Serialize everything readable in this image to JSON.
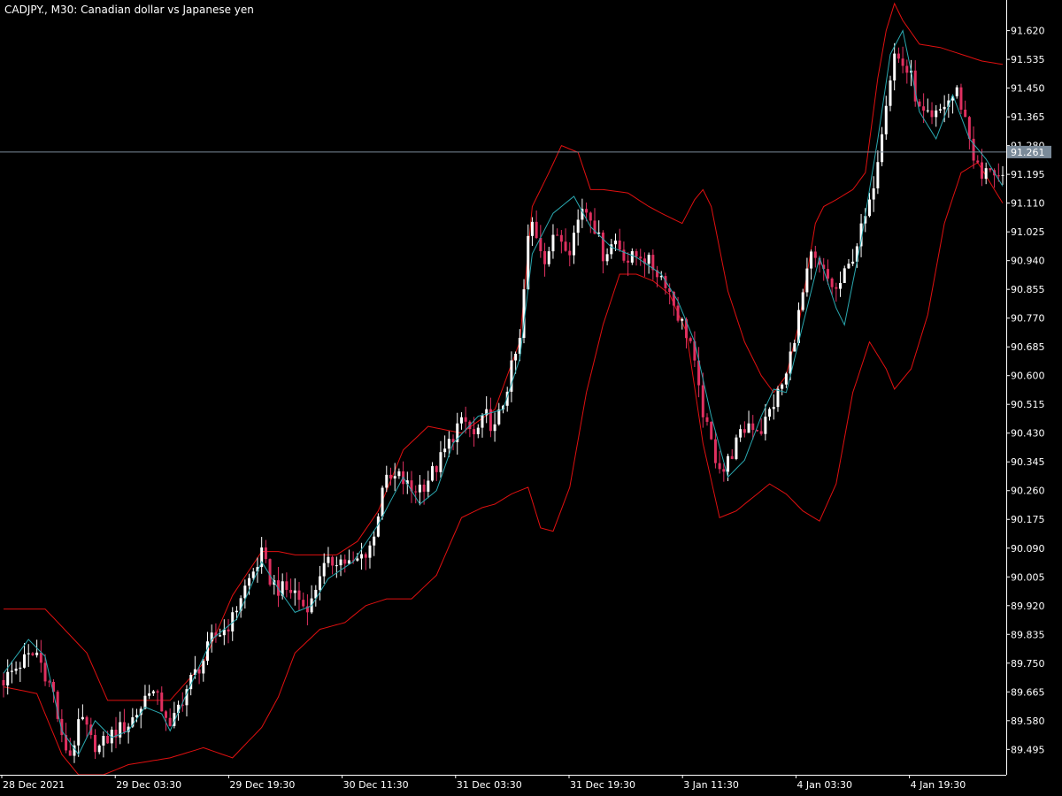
{
  "window": {
    "symbol": "CADJPY.",
    "timeframe": "M30",
    "description": "Canadian dollar vs Japanese yen",
    "title": "CADJPY., M30:  Canadian dollar vs Japanese yen"
  },
  "colors": {
    "background": "#000000",
    "frame": "#ffffff",
    "bull_candle": "#ffffff",
    "bear_candle": "#e03060",
    "bands": "#e01010",
    "signal_line": "#2aa8b0",
    "price_line": "#7a8a99",
    "price_label_bg": "#7a8a99",
    "text": "#ffffff"
  },
  "price_label": "91.261",
  "chart_data": {
    "type": "candlestick",
    "title": "CADJPY., M30:  Canadian dollar vs Japanese yen",
    "ylim": [
      89.42,
      91.7
    ],
    "y_ticks": [
      "89.495",
      "89.580",
      "89.665",
      "89.750",
      "89.835",
      "89.920",
      "90.005",
      "90.090",
      "90.175",
      "90.260",
      "90.345",
      "90.430",
      "90.515",
      "90.600",
      "90.685",
      "90.770",
      "90.855",
      "90.940",
      "91.025",
      "91.110",
      "91.195",
      "91.280",
      "91.365",
      "91.450",
      "91.535",
      "91.620"
    ],
    "x_ticks": [
      "28 Dec 2021",
      "29 Dec 03:30",
      "29 Dec 19:30",
      "30 Dec 11:30",
      "31 Dec 03:30",
      "31 Dec 19:30",
      "3 Jan 11:30",
      "4 Jan 03:30",
      "4 Jan 19:30"
    ],
    "current_price": 91.261,
    "close_path": [
      [
        0,
        89.7
      ],
      [
        5,
        89.76
      ],
      [
        8,
        89.78
      ],
      [
        10,
        89.72
      ],
      [
        12,
        89.66
      ],
      [
        14,
        89.52
      ],
      [
        16,
        89.48
      ],
      [
        18,
        89.56
      ],
      [
        19,
        89.58
      ],
      [
        21,
        89.52
      ],
      [
        23,
        89.5
      ],
      [
        26,
        89.54
      ],
      [
        30,
        89.57
      ],
      [
        33,
        89.62
      ],
      [
        35,
        89.68
      ],
      [
        37,
        89.64
      ],
      [
        39,
        89.6
      ],
      [
        40,
        89.55
      ],
      [
        42,
        89.62
      ],
      [
        45,
        89.7
      ],
      [
        48,
        89.76
      ],
      [
        50,
        89.82
      ],
      [
        53,
        89.85
      ],
      [
        55,
        89.88
      ],
      [
        57,
        89.95
      ],
      [
        60,
        90.02
      ],
      [
        62,
        90.07
      ],
      [
        64,
        90.0
      ],
      [
        66,
        89.97
      ],
      [
        70,
        89.96
      ],
      [
        72,
        89.92
      ],
      [
        74,
        89.93
      ],
      [
        76,
        90.02
      ],
      [
        80,
        90.06
      ],
      [
        84,
        90.04
      ],
      [
        87,
        90.08
      ],
      [
        89,
        90.12
      ],
      [
        91,
        90.28
      ],
      [
        95,
        90.3
      ],
      [
        98,
        90.26
      ],
      [
        101,
        90.28
      ],
      [
        104,
        90.33
      ],
      [
        107,
        90.4
      ],
      [
        109,
        90.45
      ],
      [
        111,
        90.46
      ],
      [
        113,
        90.42
      ],
      [
        116,
        90.48
      ],
      [
        118,
        90.44
      ],
      [
        120,
        90.52
      ],
      [
        122,
        90.62
      ],
      [
        124,
        90.7
      ],
      [
        125,
        90.85
      ],
      [
        126,
        91.0
      ],
      [
        127,
        91.05
      ],
      [
        130,
        90.95
      ],
      [
        133,
        91.02
      ],
      [
        136,
        90.98
      ],
      [
        139,
        91.1
      ],
      [
        141,
        91.08
      ],
      [
        144,
        90.96
      ],
      [
        147,
        91.0
      ],
      [
        150,
        90.94
      ],
      [
        153,
        90.96
      ],
      [
        156,
        90.92
      ],
      [
        159,
        90.88
      ],
      [
        162,
        90.78
      ],
      [
        165,
        90.7
      ],
      [
        167,
        90.55
      ],
      [
        169,
        90.44
      ],
      [
        171,
        90.36
      ],
      [
        173,
        90.32
      ],
      [
        176,
        90.4
      ],
      [
        179,
        90.46
      ],
      [
        182,
        90.44
      ],
      [
        185,
        90.52
      ],
      [
        188,
        90.6
      ],
      [
        190,
        90.72
      ],
      [
        192,
        90.84
      ],
      [
        194,
        90.95
      ],
      [
        197,
        90.9
      ],
      [
        200,
        90.85
      ],
      [
        203,
        90.92
      ],
      [
        206,
        91.03
      ],
      [
        208,
        91.1
      ],
      [
        210,
        91.25
      ],
      [
        212,
        91.42
      ],
      [
        214,
        91.55
      ],
      [
        216,
        91.52
      ],
      [
        218,
        91.48
      ],
      [
        220,
        91.38
      ],
      [
        223,
        91.35
      ],
      [
        226,
        91.4
      ],
      [
        229,
        91.44
      ],
      [
        231,
        91.36
      ],
      [
        233,
        91.25
      ],
      [
        235,
        91.18
      ],
      [
        237,
        91.22
      ],
      [
        240,
        91.17
      ]
    ],
    "bands_upper_path": [
      [
        0,
        89.91
      ],
      [
        10,
        89.91
      ],
      [
        20,
        89.78
      ],
      [
        25,
        89.64
      ],
      [
        30,
        89.64
      ],
      [
        40,
        89.64
      ],
      [
        48,
        89.75
      ],
      [
        55,
        89.95
      ],
      [
        62,
        90.08
      ],
      [
        66,
        90.08
      ],
      [
        70,
        90.07
      ],
      [
        80,
        90.07
      ],
      [
        85,
        90.11
      ],
      [
        90,
        90.2
      ],
      [
        96,
        90.38
      ],
      [
        102,
        90.45
      ],
      [
        110,
        90.43
      ],
      [
        118,
        90.5
      ],
      [
        124,
        90.7
      ],
      [
        127,
        91.1
      ],
      [
        131,
        91.2
      ],
      [
        134,
        91.28
      ],
      [
        138,
        91.26
      ],
      [
        141,
        91.15
      ],
      [
        144,
        91.15
      ],
      [
        150,
        91.14
      ],
      [
        155,
        91.1
      ],
      [
        158,
        91.08
      ],
      [
        163,
        91.05
      ],
      [
        166,
        91.12
      ],
      [
        168,
        91.15
      ],
      [
        170,
        91.1
      ],
      [
        174,
        90.85
      ],
      [
        178,
        90.7
      ],
      [
        182,
        90.6
      ],
      [
        185,
        90.55
      ],
      [
        188,
        90.6
      ],
      [
        191,
        90.75
      ],
      [
        193,
        90.9
      ],
      [
        195,
        91.05
      ],
      [
        197,
        91.1
      ],
      [
        200,
        91.12
      ],
      [
        204,
        91.15
      ],
      [
        207,
        91.2
      ],
      [
        210,
        91.48
      ],
      [
        212,
        91.62
      ],
      [
        214,
        91.7
      ],
      [
        216,
        91.65
      ],
      [
        220,
        91.58
      ],
      [
        225,
        91.57
      ],
      [
        230,
        91.55
      ],
      [
        235,
        91.53
      ],
      [
        240,
        91.52
      ]
    ],
    "bands_lower_path": [
      [
        0,
        89.68
      ],
      [
        8,
        89.66
      ],
      [
        14,
        89.48
      ],
      [
        18,
        89.42
      ],
      [
        24,
        89.42
      ],
      [
        30,
        89.45
      ],
      [
        40,
        89.47
      ],
      [
        48,
        89.5
      ],
      [
        55,
        89.47
      ],
      [
        62,
        89.56
      ],
      [
        66,
        89.65
      ],
      [
        70,
        89.78
      ],
      [
        76,
        89.85
      ],
      [
        82,
        89.87
      ],
      [
        87,
        89.92
      ],
      [
        92,
        89.94
      ],
      [
        98,
        89.94
      ],
      [
        104,
        90.01
      ],
      [
        110,
        90.18
      ],
      [
        115,
        90.21
      ],
      [
        118,
        90.22
      ],
      [
        122,
        90.25
      ],
      [
        126,
        90.27
      ],
      [
        129,
        90.15
      ],
      [
        132,
        90.14
      ],
      [
        136,
        90.27
      ],
      [
        140,
        90.55
      ],
      [
        144,
        90.75
      ],
      [
        148,
        90.9
      ],
      [
        152,
        90.9
      ],
      [
        156,
        90.88
      ],
      [
        160,
        90.84
      ],
      [
        164,
        90.73
      ],
      [
        168,
        90.4
      ],
      [
        172,
        90.18
      ],
      [
        176,
        90.2
      ],
      [
        180,
        90.24
      ],
      [
        184,
        90.28
      ],
      [
        188,
        90.25
      ],
      [
        192,
        90.2
      ],
      [
        196,
        90.17
      ],
      [
        200,
        90.28
      ],
      [
        204,
        90.55
      ],
      [
        208,
        90.7
      ],
      [
        212,
        90.62
      ],
      [
        214,
        90.56
      ],
      [
        218,
        90.62
      ],
      [
        222,
        90.78
      ],
      [
        226,
        91.05
      ],
      [
        230,
        91.2
      ],
      [
        234,
        91.23
      ],
      [
        240,
        91.11
      ]
    ],
    "signal_path": [
      [
        0,
        89.72
      ],
      [
        6,
        89.82
      ],
      [
        10,
        89.77
      ],
      [
        14,
        89.55
      ],
      [
        18,
        89.48
      ],
      [
        22,
        89.58
      ],
      [
        26,
        89.53
      ],
      [
        30,
        89.55
      ],
      [
        34,
        89.62
      ],
      [
        38,
        89.6
      ],
      [
        40,
        89.55
      ],
      [
        44,
        89.66
      ],
      [
        50,
        89.82
      ],
      [
        56,
        89.88
      ],
      [
        62,
        90.05
      ],
      [
        66,
        89.97
      ],
      [
        70,
        89.9
      ],
      [
        74,
        89.92
      ],
      [
        78,
        90.0
      ],
      [
        84,
        90.05
      ],
      [
        90,
        90.16
      ],
      [
        96,
        90.3
      ],
      [
        100,
        90.22
      ],
      [
        104,
        90.26
      ],
      [
        108,
        90.4
      ],
      [
        114,
        90.48
      ],
      [
        120,
        90.5
      ],
      [
        124,
        90.65
      ],
      [
        127,
        90.96
      ],
      [
        132,
        91.08
      ],
      [
        137,
        91.13
      ],
      [
        141,
        91.04
      ],
      [
        146,
        90.98
      ],
      [
        152,
        90.95
      ],
      [
        158,
        90.9
      ],
      [
        162,
        90.82
      ],
      [
        166,
        90.7
      ],
      [
        170,
        90.48
      ],
      [
        174,
        90.3
      ],
      [
        178,
        90.35
      ],
      [
        182,
        90.48
      ],
      [
        185,
        90.56
      ],
      [
        188,
        90.55
      ],
      [
        192,
        90.75
      ],
      [
        196,
        90.95
      ],
      [
        200,
        90.8
      ],
      [
        202,
        90.75
      ],
      [
        206,
        91.0
      ],
      [
        210,
        91.3
      ],
      [
        213,
        91.55
      ],
      [
        216,
        91.62
      ],
      [
        220,
        91.38
      ],
      [
        224,
        91.3
      ],
      [
        228,
        91.43
      ],
      [
        232,
        91.3
      ],
      [
        236,
        91.24
      ],
      [
        240,
        91.16
      ]
    ]
  }
}
